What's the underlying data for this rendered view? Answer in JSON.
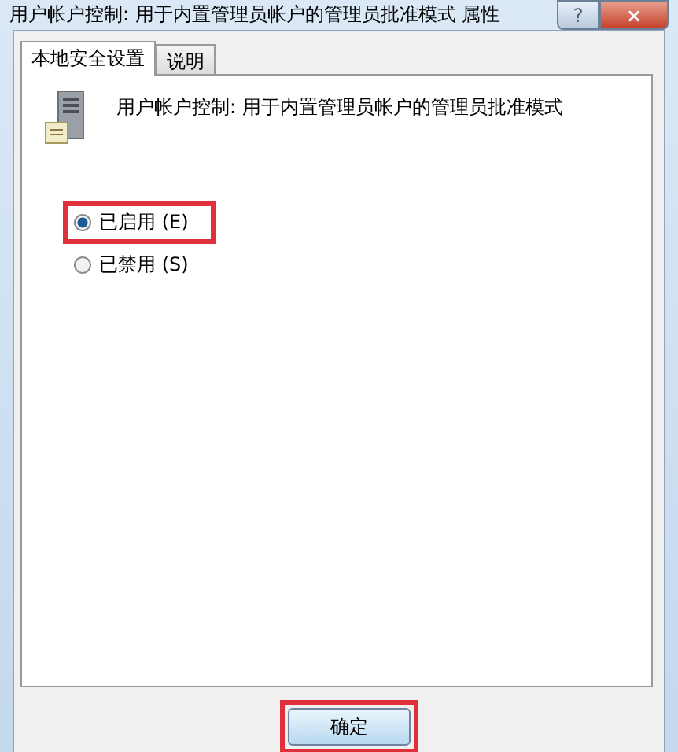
{
  "window": {
    "title": "用户帐户控制: 用于内置管理员帐户的管理员批准模式 属性",
    "help_button": "?",
    "close_button": "×"
  },
  "tabs": [
    {
      "label": "本地安全设置",
      "selected": true
    },
    {
      "label": "说明",
      "selected": false
    }
  ],
  "policy": {
    "name": "用户帐户控制: 用于内置管理员帐户的管理员批准模式"
  },
  "options": [
    {
      "label": "已启用 (E)",
      "selected": true,
      "highlighted": true
    },
    {
      "label": "已禁用 (S)",
      "selected": false,
      "highlighted": false
    }
  ],
  "buttons": [
    {
      "label": "确定",
      "highlighted": true
    }
  ]
}
